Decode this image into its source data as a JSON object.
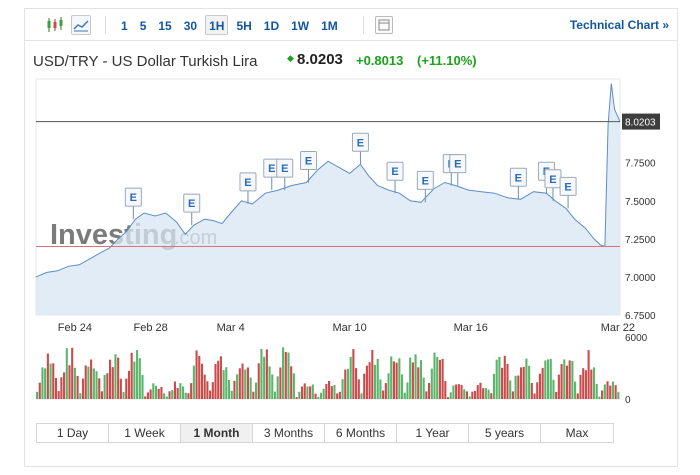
{
  "toolbar": {
    "chart_type_icons": [
      "candlestick-icon",
      "area-chart-icon"
    ],
    "periods": [
      "1",
      "5",
      "15",
      "30",
      "1H",
      "5H",
      "1D",
      "1W",
      "1M"
    ],
    "active_period": "1H",
    "calendar_icon": "calendar-icon",
    "technical_link": "Technical Chart »"
  },
  "header": {
    "title": "USD/TRY - US Dollar Turkish Lira",
    "price": "8.0203",
    "change": "+0.8013",
    "change_pct": "(+11.10%)",
    "up_color": "#1aa31a"
  },
  "watermark": {
    "brand": "Investing",
    "suffix": ".com"
  },
  "ranges": [
    "1 Day",
    "1 Week",
    "1 Month",
    "3 Months",
    "6 Months",
    "1 Year",
    "5 years",
    "Max"
  ],
  "active_range": "1 Month",
  "chart_data": {
    "type": "area",
    "x_ticks": [
      "Feb 24",
      "Feb 28",
      "Mar 4",
      "Mar 10",
      "Mar 16",
      "Mar 22"
    ],
    "y_ticks": [
      "8.0203",
      "7.7500",
      "7.5000",
      "7.2500",
      "7.0000",
      "6.7500"
    ],
    "ylim": [
      6.75,
      8.3
    ],
    "x_range_days": [
      0,
      27
    ],
    "last_price": 8.0203,
    "last_price_label": "8.0203",
    "prev_close_line": 7.2,
    "series": [
      {
        "points": [
          [
            0,
            7.0
          ],
          [
            0.5,
            7.03
          ],
          [
            1,
            7.04
          ],
          [
            1.5,
            7.07
          ],
          [
            2,
            7.08
          ],
          [
            2.5,
            7.12
          ],
          [
            3,
            7.16
          ],
          [
            3.4,
            7.19
          ],
          [
            3.8,
            7.25
          ],
          [
            4.2,
            7.3
          ],
          [
            4.6,
            7.38
          ],
          [
            5,
            7.42
          ],
          [
            5.5,
            7.4
          ],
          [
            6,
            7.42
          ],
          [
            6.5,
            7.36
          ],
          [
            6.9,
            7.28
          ],
          [
            7.3,
            7.34
          ],
          [
            7.8,
            7.38
          ],
          [
            8.2,
            7.37
          ],
          [
            8.6,
            7.35
          ],
          [
            9,
            7.42
          ],
          [
            9.5,
            7.5
          ],
          [
            10,
            7.48
          ],
          [
            10.6,
            7.55
          ],
          [
            11.2,
            7.57
          ],
          [
            11.8,
            7.6
          ],
          [
            12.5,
            7.62
          ],
          [
            13,
            7.7
          ],
          [
            13.5,
            7.76
          ],
          [
            14,
            7.72
          ],
          [
            14.5,
            7.68
          ],
          [
            15,
            7.74
          ],
          [
            15.4,
            7.66
          ],
          [
            15.8,
            7.6
          ],
          [
            16.3,
            7.57
          ],
          [
            16.8,
            7.55
          ],
          [
            17.3,
            7.5
          ],
          [
            17.8,
            7.49
          ],
          [
            18.4,
            7.58
          ],
          [
            18.9,
            7.62
          ],
          [
            19.4,
            7.6
          ],
          [
            20,
            7.57
          ],
          [
            20.6,
            7.56
          ],
          [
            21.2,
            7.55
          ],
          [
            21.8,
            7.52
          ],
          [
            22.4,
            7.51
          ],
          [
            23,
            7.56
          ],
          [
            23.6,
            7.55
          ],
          [
            24,
            7.5
          ],
          [
            24.5,
            7.45
          ],
          [
            24.9,
            7.38
          ],
          [
            25.4,
            7.32
          ],
          [
            25.8,
            7.25
          ],
          [
            26.1,
            7.21
          ],
          [
            26.3,
            7.2
          ],
          [
            26.45,
            8.0
          ],
          [
            26.6,
            8.27
          ],
          [
            26.75,
            8.1
          ],
          [
            27,
            8.02
          ]
        ]
      }
    ],
    "events": [
      {
        "day": 4.5,
        "label": "E"
      },
      {
        "day": 7.2,
        "label": "E"
      },
      {
        "day": 9.8,
        "label": "E"
      },
      {
        "day": 10.9,
        "label": "E"
      },
      {
        "day": 11.5,
        "label": "E"
      },
      {
        "day": 12.6,
        "label": "E"
      },
      {
        "day": 15.0,
        "label": "E"
      },
      {
        "day": 16.6,
        "label": "E"
      },
      {
        "day": 18.0,
        "label": "E"
      },
      {
        "day": 19.2,
        "label": "E"
      },
      {
        "day": 19.5,
        "label": "E"
      },
      {
        "day": 22.3,
        "label": "E"
      },
      {
        "day": 23.6,
        "label": "E"
      },
      {
        "day": 23.9,
        "label": "E"
      },
      {
        "day": 24.6,
        "label": "E"
      }
    ],
    "volume": {
      "y_ticks": [
        "6000",
        "0"
      ],
      "ylim": [
        0,
        6000
      ],
      "up_color": "#5bb56a",
      "down_color": "#c94b4b",
      "bars_per_day": 8
    }
  }
}
